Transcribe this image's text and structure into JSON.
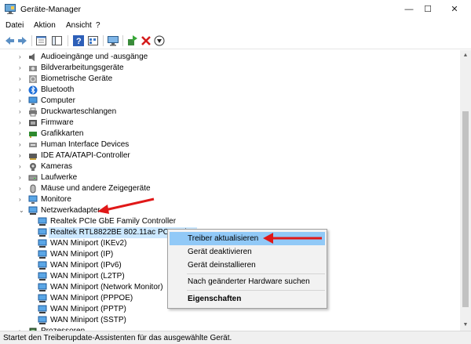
{
  "window": {
    "title": "Geräte-Manager",
    "icon": "device-manager-icon",
    "controls": {
      "minimize": "—",
      "maximize": "☐",
      "close": "✕"
    }
  },
  "menu": [
    "Datei",
    "Aktion",
    "Ansicht",
    "?"
  ],
  "toolbar": [
    "back-icon",
    "forward-icon",
    "properties-icon",
    "show-hide-console-tree-icon",
    "help-icon",
    "view-icon",
    "monitor-scan-icon",
    "update-driver-icon",
    "uninstall-icon",
    "download-icon"
  ],
  "tree": {
    "categories_top": [
      {
        "label": "Audioeingänge und -ausgänge",
        "icon": "speaker-icon"
      },
      {
        "label": "Bildverarbeitungsgeräte",
        "icon": "camera-icon"
      },
      {
        "label": "Biometrische Geräte",
        "icon": "fingerprint-icon"
      },
      {
        "label": "Bluetooth",
        "icon": "bluetooth-icon"
      },
      {
        "label": "Computer",
        "icon": "computer-icon"
      },
      {
        "label": "Druckwarteschlangen",
        "icon": "printer-icon"
      },
      {
        "label": "Firmware",
        "icon": "firmware-icon"
      },
      {
        "label": "Grafikkarten",
        "icon": "display-adapter-icon"
      },
      {
        "label": "Human Interface Devices",
        "icon": "hid-icon"
      },
      {
        "label": "IDE ATA/ATAPI-Controller",
        "icon": "ide-controller-icon"
      },
      {
        "label": "Kameras",
        "icon": "webcam-icon"
      },
      {
        "label": "Laufwerke",
        "icon": "drive-icon"
      },
      {
        "label": "Mäuse und andere Zeigegeräte",
        "icon": "mouse-icon"
      },
      {
        "label": "Monitore",
        "icon": "monitor-icon"
      }
    ],
    "expanded_category": {
      "label": "Netzwerkadapter",
      "icon": "network-adapter-icon"
    },
    "network_adapters": [
      "Realtek PCIe GbE Family Controller",
      "Realtek RTL8822BE 802.11ac PCIe Adapter",
      "WAN Miniport (IKEv2)",
      "WAN Miniport (IP)",
      "WAN Miniport (IPv6)",
      "WAN Miniport (L2TP)",
      "WAN Miniport (Network Monitor)",
      "WAN Miniport (PPPOE)",
      "WAN Miniport (PPTP)",
      "WAN Miniport (SSTP)"
    ],
    "selected_visible_text": "Realtek RTL8822BE 802.11ac PCIe Adap",
    "categories_bottom": [
      {
        "label": "Prozessoren",
        "icon": "processor-icon"
      }
    ]
  },
  "context_menu": {
    "items": [
      "Treiber aktualisieren",
      "Gerät deaktivieren",
      "Gerät deinstallieren",
      "Nach geänderter Hardware suchen",
      "Eigenschaften"
    ],
    "highlighted": "Treiber aktualisieren",
    "default_item": "Eigenschaften"
  },
  "status_bar": "Startet den Treiberupdate-Assistenten für das ausgewählte Gerät.",
  "colors": {
    "selection": "#cce8ff",
    "menu_highlight": "#91c9f7",
    "annotation_arrow": "#e01818"
  }
}
